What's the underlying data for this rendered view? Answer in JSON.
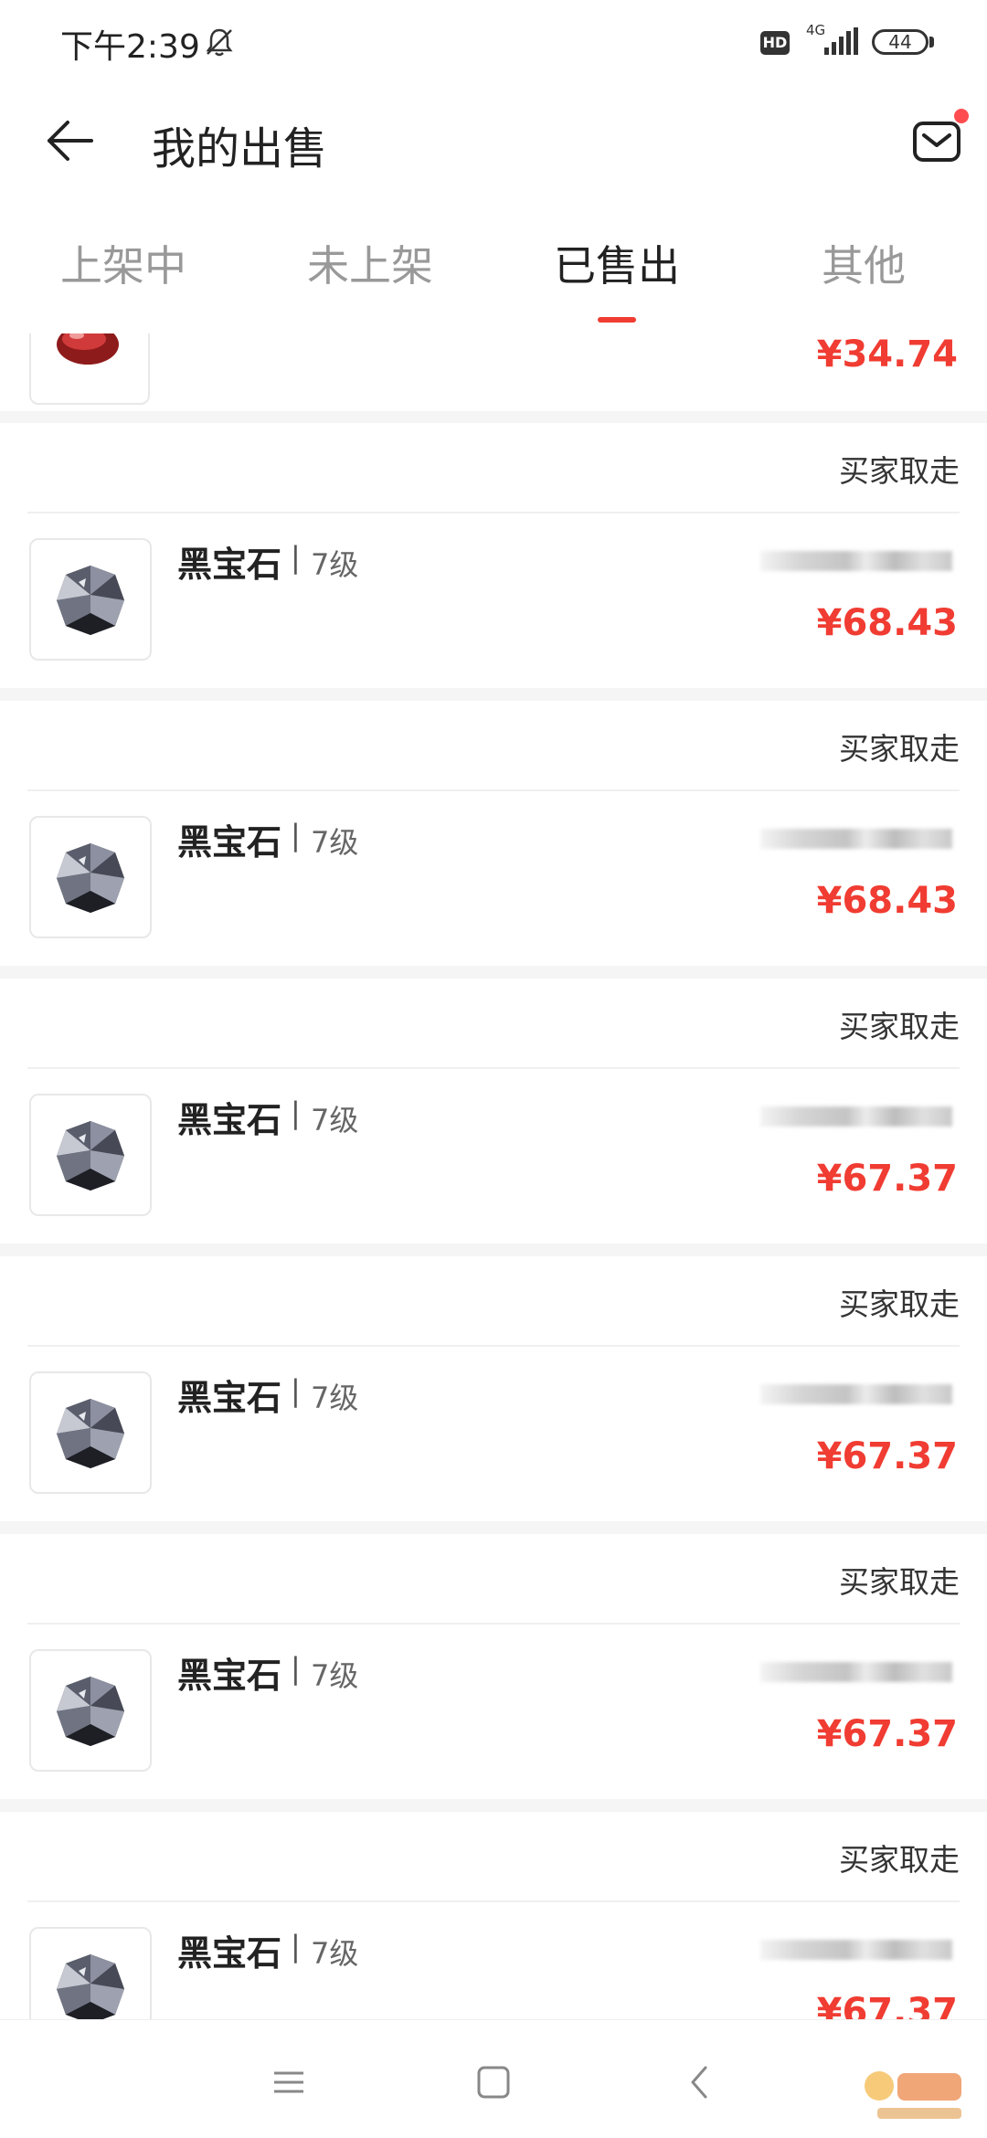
{
  "status_bar": {
    "time": "下午2:39",
    "hd": "HD",
    "network": "4G",
    "battery": "44"
  },
  "header": {
    "title": "我的出售"
  },
  "tabs": [
    {
      "label": "上架中",
      "active": false
    },
    {
      "label": "未上架",
      "active": false
    },
    {
      "label": "已售出",
      "active": true
    },
    {
      "label": "其他",
      "active": false
    }
  ],
  "partial_item": {
    "price": "¥34.74"
  },
  "orders": [
    {
      "status": "买家取走",
      "name": "黑宝石",
      "separator": "|",
      "level": "7级",
      "price": "¥68.43"
    },
    {
      "status": "买家取走",
      "name": "黑宝石",
      "separator": "|",
      "level": "7级",
      "price": "¥68.43"
    },
    {
      "status": "买家取走",
      "name": "黑宝石",
      "separator": "|",
      "level": "7级",
      "price": "¥67.37"
    },
    {
      "status": "买家取走",
      "name": "黑宝石",
      "separator": "|",
      "level": "7级",
      "price": "¥67.37"
    },
    {
      "status": "买家取走",
      "name": "黑宝石",
      "separator": "|",
      "level": "7级",
      "price": "¥67.37"
    },
    {
      "status": "买家取走",
      "name": "黑宝石",
      "separator": "|",
      "level": "7级",
      "price": "¥67.37"
    }
  ],
  "colors": {
    "accent": "#f03c32",
    "background": "#f5f5f5"
  },
  "icons": {
    "back": "back-arrow-icon",
    "mail": "mail-icon",
    "bell": "bell-muted-icon",
    "item": "black-gem-icon",
    "nav": [
      "menu-icon",
      "home-icon",
      "back-nav-icon"
    ]
  }
}
